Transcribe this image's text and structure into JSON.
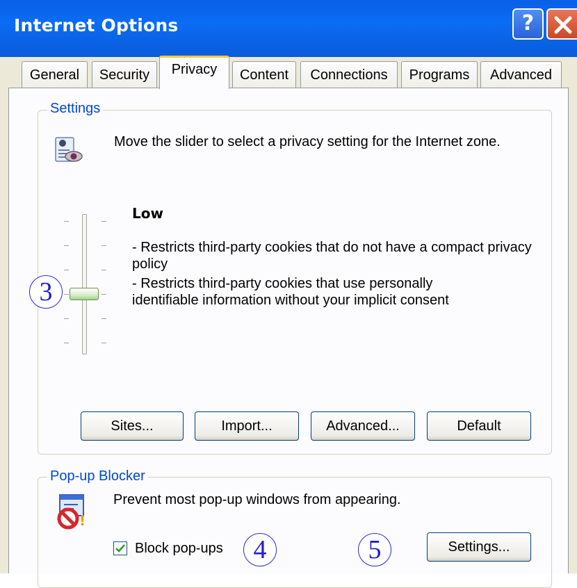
{
  "window": {
    "title": "Internet Options",
    "help_glyph": "?",
    "close_icon": "close-x-icon"
  },
  "tabs": [
    "General",
    "Security",
    "Privacy",
    "Content",
    "Connections",
    "Programs",
    "Advanced"
  ],
  "active_tab": "Privacy",
  "settings": {
    "legend": "Settings",
    "intro": "Move the slider to select a privacy setting for the Internet zone.",
    "level_title": "Low",
    "description": [
      "- Restricts third-party cookies that do not have a compact privacy policy",
      "- Restricts third-party cookies that use personally identifiable information without your implicit consent"
    ],
    "slider_level": 2,
    "slider_steps": 6,
    "buttons": {
      "sites": "Sites...",
      "import": "Import...",
      "advanced": "Advanced...",
      "default": "Default"
    }
  },
  "popup": {
    "legend": "Pop-up Blocker",
    "intro": "Prevent most pop-up windows from appearing.",
    "checkbox_label": "Block pop-ups",
    "checkbox_checked": true,
    "settings_button": "Settings..."
  },
  "callouts": [
    "3",
    "4",
    "5"
  ],
  "colors": {
    "titlebar": "#0b6cf4",
    "dialog_bg": "#ece9d8",
    "legend_text": "#0046d5",
    "active_tab_accent": "#ffc83c",
    "callout": "#2020cc"
  }
}
